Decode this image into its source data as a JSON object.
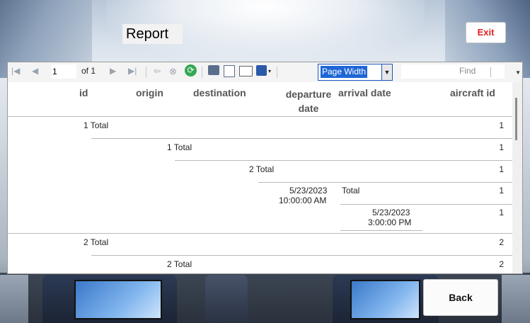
{
  "window": {
    "title": "Report",
    "exit_label": "Exit",
    "back_label": "Back"
  },
  "toolbar": {
    "page_current": "1",
    "page_of": "of 1",
    "zoom_value": "Page Width",
    "find_label": "Find"
  },
  "columns": [
    "id",
    "origin",
    "destination",
    "departure date",
    "arrival date",
    "aircraft id"
  ],
  "rows": [
    {
      "label": "1 Total",
      "count": "1"
    },
    {
      "label": "1 Total",
      "count": "1"
    },
    {
      "label": "2 Total",
      "count": "1"
    },
    {
      "label_date": "5/23/2023",
      "label_time": "10:00:00 AM",
      "label_total": "Total",
      "count": "1"
    },
    {
      "label_date": "5/23/2023",
      "label_time": "3:00:00 PM",
      "count": "1"
    },
    {
      "label": "2 Total",
      "count": "2"
    },
    {
      "label": "2 Total",
      "count": "2"
    }
  ],
  "colors": {
    "exit": "#e02020",
    "zoom_highlight": "#1e66d6"
  }
}
